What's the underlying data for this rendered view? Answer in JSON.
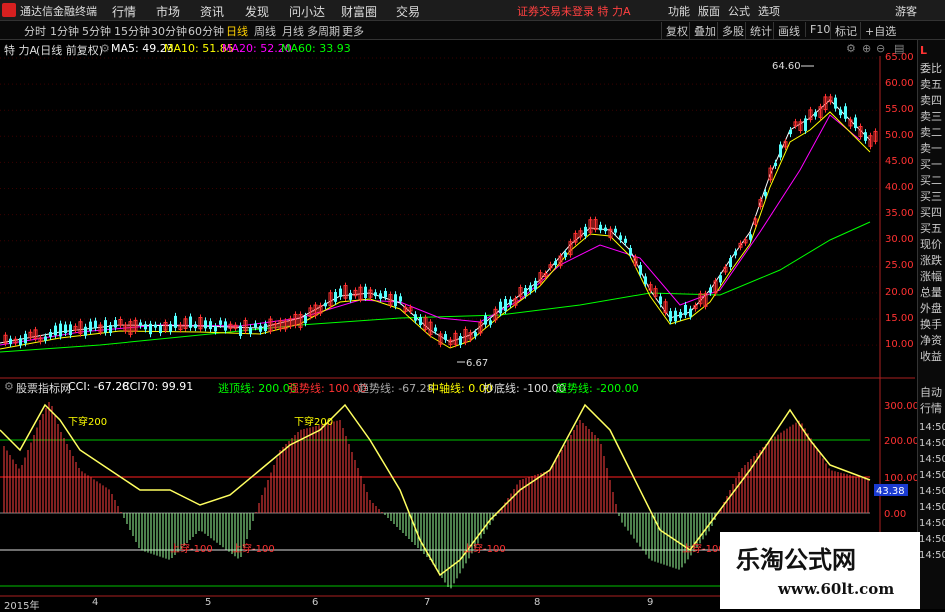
{
  "menubar": {
    "app_title": "通达信金融终端",
    "items": [
      "行情",
      "市场",
      "资讯",
      "发现",
      "问小达",
      "财富圈",
      "交易"
    ],
    "login_notice": "证券交易未登录  特 力A",
    "right_items": [
      "功能",
      "版面",
      "公式",
      "选项",
      "游客"
    ]
  },
  "toolbar": {
    "periods": [
      "分时",
      "1分钟",
      "5分钟",
      "15分钟",
      "30分钟",
      "60分钟",
      "日线",
      "周线",
      "月线",
      "多周期",
      "更多"
    ],
    "active_period": "日线",
    "right_buttons": [
      "复权",
      "叠加",
      "多股",
      "统计",
      "画线",
      "F10",
      "标记",
      "+自选"
    ]
  },
  "price_panel": {
    "stock_name": "特 力A",
    "adjust_note": "(日线 前复权)",
    "ma5": "MA5: 49.23",
    "ma10": "MA10: 51.85",
    "ma20": "MA20: 52.20",
    "ma60": "MA60: 33.93",
    "high_label": "64.60",
    "low_label": "6.67",
    "y_ticks": [
      "65.00",
      "60.00",
      "55.00",
      "50.00",
      "45.00",
      "40.00",
      "35.00",
      "30.00",
      "25.00",
      "20.00",
      "15.00",
      "10.00"
    ]
  },
  "indicator_panel": {
    "name": "股票指标网",
    "cci": "CCI: -67.28",
    "cci70": "CCI70: 99.91",
    "blue_line": "",
    "escape_line": "逃顶线: 200.00",
    "strong_line": "强势线: 100.00",
    "trend_line": "趋势线: -67.28",
    "center_line": "中轴线: 0.00",
    "bottom_line": "抄底线: -100.00",
    "super_bottom": "超势线: -200.00",
    "y_ticks": [
      "300.00",
      "200.00",
      "100.00",
      "0.00",
      "-100.00",
      "-200.00"
    ],
    "current_value": "43.38",
    "annotations": [
      "下穿200",
      "下穿200",
      "上穿-100",
      "上穿-100",
      "上穿-100",
      "上穿-100"
    ]
  },
  "sidebar": {
    "top_items": [
      "委比",
      "卖五",
      "卖四",
      "卖三",
      "卖二",
      "卖一",
      "买一",
      "买二",
      "买三",
      "买四",
      "买五",
      "现价",
      "涨跌",
      "涨幅",
      "总量",
      "外盘",
      "换手",
      "净资",
      "收益"
    ],
    "bottom_items": [
      "自动",
      "行情",
      "14:50",
      "14:50",
      "14:50",
      "14:50",
      "14:50",
      "14:50",
      "14:50",
      "14:50",
      "14:50"
    ]
  },
  "x_axis": [
    "2015年",
    "4",
    "5",
    "6",
    "7",
    "8",
    "9"
  ],
  "watermark": {
    "title": "乐淘公式网",
    "url": "www.60lt.com"
  },
  "colors": {
    "up": "#ff3232",
    "down": "#54ffff",
    "ma5": "#ffffff",
    "ma10": "#ffff00",
    "ma20": "#ff00ff",
    "ma60": "#00ff00"
  }
}
